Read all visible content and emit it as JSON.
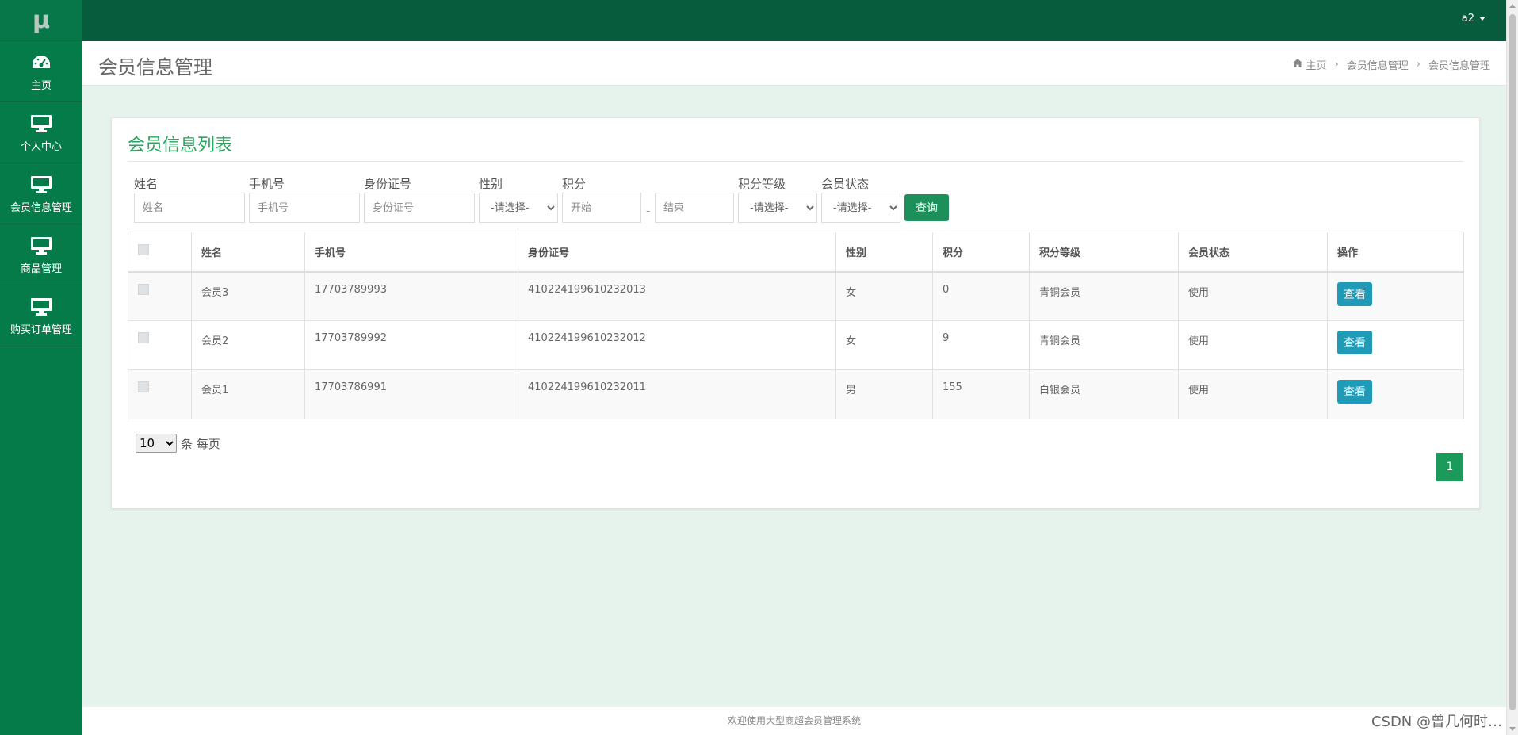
{
  "brand": "μ",
  "sidebar": {
    "items": [
      {
        "label": "主页",
        "icon": "dashboard-icon"
      },
      {
        "label": "个人中心",
        "icon": "monitor-icon"
      },
      {
        "label": "会员信息管理",
        "icon": "monitor-icon"
      },
      {
        "label": "商品管理",
        "icon": "monitor-icon"
      },
      {
        "label": "购买订单管理",
        "icon": "monitor-icon"
      }
    ]
  },
  "topbar": {
    "user": "a2"
  },
  "header": {
    "title": "会员信息管理",
    "breadcrumb": [
      "主页",
      "会员信息管理",
      "会员信息管理"
    ]
  },
  "panel": {
    "title": "会员信息列表"
  },
  "filters": {
    "name": {
      "label": "姓名",
      "placeholder": "姓名"
    },
    "phone": {
      "label": "手机号",
      "placeholder": "手机号"
    },
    "idcard": {
      "label": "身份证号",
      "placeholder": "身份证号"
    },
    "gender": {
      "label": "性别",
      "selected": "-请选择-"
    },
    "points": {
      "label": "积分",
      "start_placeholder": "开始",
      "separator": "-",
      "end_placeholder": "结束"
    },
    "level": {
      "label": "积分等级",
      "selected": "-请选择-"
    },
    "status": {
      "label": "会员状态",
      "selected": "-请选择-"
    },
    "query_button": "查询"
  },
  "table": {
    "columns": [
      "姓名",
      "手机号",
      "身份证号",
      "性别",
      "积分",
      "积分等级",
      "会员状态",
      "操作"
    ],
    "rows": [
      {
        "name": "会员3",
        "phone": "17703789993",
        "idcard": "410224199610232013",
        "gender": "女",
        "points": "0",
        "level": "青铜会员",
        "status": "使用",
        "action": "查看"
      },
      {
        "name": "会员2",
        "phone": "17703789992",
        "idcard": "410224199610232012",
        "gender": "女",
        "points": "9",
        "level": "青铜会员",
        "status": "使用",
        "action": "查看"
      },
      {
        "name": "会员1",
        "phone": "17703786991",
        "idcard": "410224199610232011",
        "gender": "男",
        "points": "155",
        "level": "白银会员",
        "status": "使用",
        "action": "查看"
      }
    ]
  },
  "pagination": {
    "page_size": "10",
    "page_size_suffix": "条 每页",
    "current_page": "1"
  },
  "footer": "欢迎使用大型商超会员管理系统",
  "watermark": "CSDN @曾几何时…",
  "colors": {
    "sidebar": "#067b4a",
    "topbar": "#065c3c",
    "accent": "#28a55f",
    "content_bg": "#e6f2ec",
    "view_button": "#1f9bb8"
  }
}
